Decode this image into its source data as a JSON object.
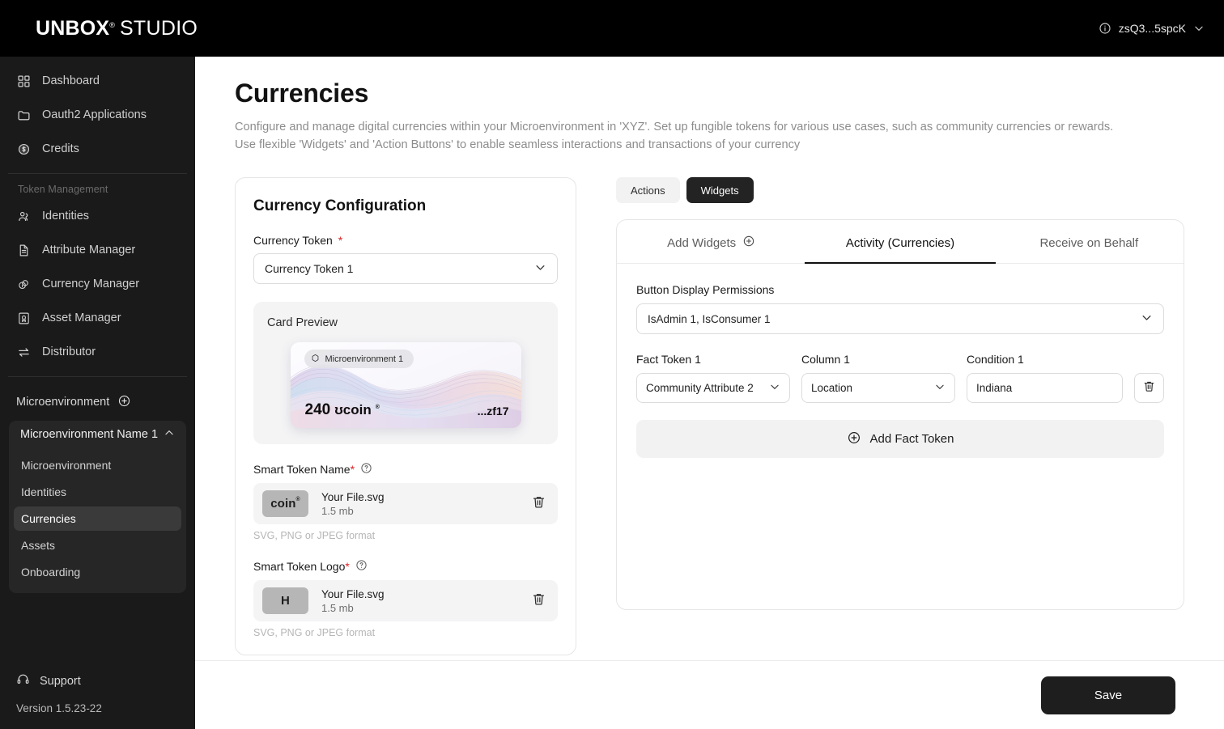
{
  "topbar": {
    "logo_mark": "U",
    "logo_name": "NBOX",
    "logo_reg": "®",
    "logo_suffix": "STUDIO",
    "account_label": "zsQ3...5spcK"
  },
  "sidebar": {
    "nav": [
      {
        "label": "Dashboard",
        "icon": "grid-icon"
      },
      {
        "label": "Oauth2 Applications",
        "icon": "folder-icon"
      },
      {
        "label": "Credits",
        "icon": "dollar-circle-icon"
      }
    ],
    "section_label": "Token Management",
    "token_nav": [
      {
        "label": "Identities",
        "icon": "users-icon"
      },
      {
        "label": "Attribute Manager",
        "icon": "document-icon"
      },
      {
        "label": "Currency Manager",
        "icon": "coins-info-icon"
      },
      {
        "label": "Asset Manager",
        "icon": "certificate-icon"
      },
      {
        "label": "Distributor",
        "icon": "transfer-icon"
      }
    ],
    "microenvironment_label": "Microenvironment",
    "group_title": "Microenvironment Name 1",
    "group_items": [
      {
        "label": "Microenvironment",
        "active": false
      },
      {
        "label": "Identities",
        "active": false
      },
      {
        "label": "Currencies",
        "active": true
      },
      {
        "label": "Assets",
        "active": false
      },
      {
        "label": "Onboarding",
        "active": false
      }
    ],
    "support_label": "Support",
    "version": "Version 1.5.23-22"
  },
  "page": {
    "title": "Currencies",
    "description": "Configure and manage digital currencies within your Microenvironment in 'XYZ'. Set up fungible tokens for various use cases, such as community currencies or rewards. Use flexible 'Widgets' and 'Action Buttons' to enable seamless interactions and transactions of your currency"
  },
  "config_card": {
    "heading": "Currency Configuration",
    "currency_token_label": "Currency Token",
    "currency_token_required": "*",
    "currency_token_value": "Currency Token 1",
    "preview_heading": "Card Preview",
    "card": {
      "chip_label": "Microenvironment 1",
      "amount": "240",
      "unit": "ʊcoin",
      "unit_reg": "®",
      "reference": "...zf17"
    },
    "smart_token_name": {
      "label": "Smart Token Name",
      "required": "*",
      "thumb_text": "coin",
      "thumb_reg": "®",
      "file_name": "Your File.svg",
      "file_size": "1.5 mb",
      "hint": "SVG, PNG or JPEG format"
    },
    "smart_token_logo": {
      "label": "Smart Token Logo",
      "required": "*",
      "thumb_text": "H",
      "file_name": "Your File.svg",
      "file_size": "1.5 mb",
      "hint": "SVG, PNG or JPEG format"
    }
  },
  "right_panel": {
    "pills": [
      {
        "label": "Actions",
        "active": false
      },
      {
        "label": "Widgets",
        "active": true
      }
    ],
    "tabs": [
      {
        "label": "Add Widgets",
        "active": false,
        "icon": "plus-circle-icon"
      },
      {
        "label": "Activity (Currencies)",
        "active": true
      },
      {
        "label": "Receive on Behalf",
        "active": false
      }
    ],
    "button_display_permissions": {
      "label": "Button Display Permissions",
      "value": "IsAdmin 1, IsConsumer 1"
    },
    "fact_row": {
      "fact_token_label": "Fact Token 1",
      "fact_token_value": "Community Attribute 2",
      "column_label": "Column 1",
      "column_value": "Location",
      "condition_label": "Condition 1",
      "condition_value": "Indiana"
    },
    "add_fact_token_label": "Add Fact Token"
  },
  "footer": {
    "save_label": "Save"
  },
  "colors": {
    "topbar_bg": "#000000",
    "sidebar_bg": "#1a1a1a",
    "accent_dark": "#1e1e1e",
    "required_red": "#e02424",
    "active_item_bg": "#3a3a3a"
  }
}
